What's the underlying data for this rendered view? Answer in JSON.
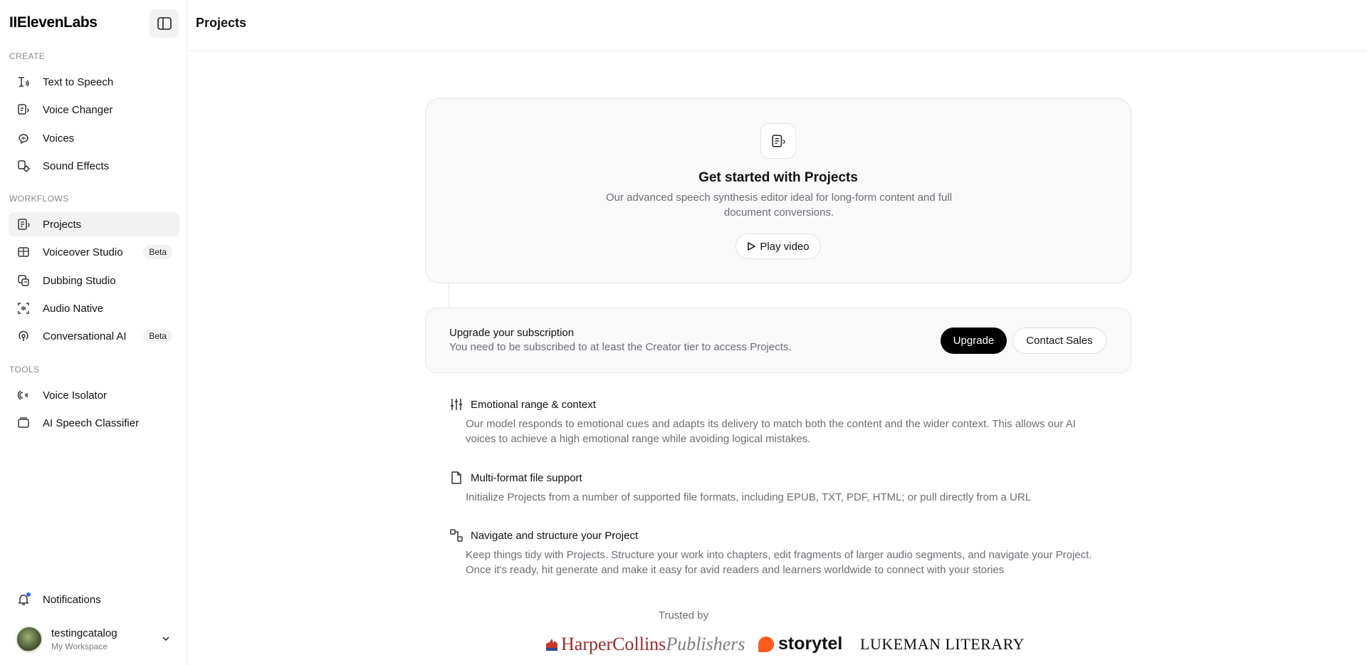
{
  "app": {
    "brand": "IIElevenLabs"
  },
  "sidebar": {
    "sections": {
      "create": "CREATE",
      "workflows": "WORKFLOWS",
      "tools": "TOOLS"
    },
    "create_items": [
      {
        "label": "Text to Speech",
        "icon": "text-to-speech-icon"
      },
      {
        "label": "Voice Changer",
        "icon": "voice-changer-icon"
      },
      {
        "label": "Voices",
        "icon": "voices-icon"
      },
      {
        "label": "Sound Effects",
        "icon": "sound-effects-icon"
      }
    ],
    "workflow_items": [
      {
        "label": "Projects",
        "icon": "projects-icon",
        "active": true
      },
      {
        "label": "Voiceover Studio",
        "icon": "voiceover-studio-icon",
        "badge": "Beta"
      },
      {
        "label": "Dubbing Studio",
        "icon": "dubbing-studio-icon"
      },
      {
        "label": "Audio Native",
        "icon": "audio-native-icon"
      },
      {
        "label": "Conversational AI",
        "icon": "conversational-ai-icon",
        "badge": "Beta"
      }
    ],
    "tool_items": [
      {
        "label": "Voice Isolator",
        "icon": "voice-isolator-icon"
      },
      {
        "label": "AI Speech Classifier",
        "icon": "ai-speech-classifier-icon"
      }
    ],
    "notifications_label": "Notifications",
    "user": {
      "name": "testingcatalog",
      "workspace": "My Workspace"
    }
  },
  "header": {
    "title": "Projects"
  },
  "hero": {
    "title": "Get started with Projects",
    "description": "Our advanced speech synthesis editor ideal for long-form content and full document conversions.",
    "play_label": "Play video"
  },
  "upgrade": {
    "title": "Upgrade your subscription",
    "description": "You need to be subscribed to at least the Creator tier to access Projects.",
    "upgrade_label": "Upgrade",
    "contact_label": "Contact Sales"
  },
  "features": [
    {
      "title": "Emotional range & context",
      "description": "Our model responds to emotional cues and adapts its delivery to match both the content and the wider context. This allows our AI voices to achieve a high emotional range while avoiding logical mistakes.",
      "icon": "sliders-icon"
    },
    {
      "title": "Multi-format file support",
      "description": "Initialize Projects from a number of supported file formats, including EPUB, TXT, PDF, HTML; or pull directly from a URL",
      "icon": "file-icon"
    },
    {
      "title": "Navigate and structure your Project",
      "description": "Keep things tidy with Projects. Structure your work into chapters, edit fragments of larger audio segments, and navigate your Project. Once it's ready, hit generate and make it easy for avid readers and learners worldwide to connect with your stories",
      "icon": "structure-icon"
    }
  ],
  "trusted": {
    "label": "Trusted by",
    "logos": {
      "harper_main": "HarperCollins",
      "harper_sub": "Publishers",
      "storytel": "storytel",
      "lukeman": "LUKEMAN LITERARY"
    }
  },
  "colors": {
    "accent": "#000000",
    "notification_dot": "#2f6bff",
    "storytel_orange": "#ff5a1f",
    "harper_red": "#9c2b2b"
  }
}
